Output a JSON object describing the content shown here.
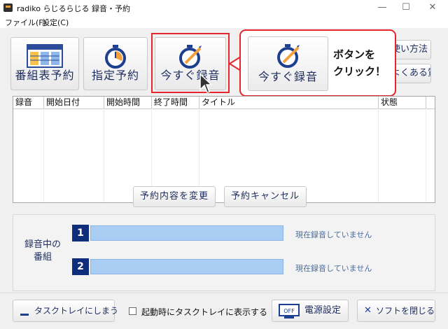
{
  "window": {
    "title": "radiko らじるらじる 録音・予約",
    "minimize_glyph": "—",
    "maximize_glyph": "☐",
    "close_glyph": "✕"
  },
  "menu": {
    "items": [
      "ファイル(F)",
      "設定(C)"
    ]
  },
  "toolbar": {
    "buttons": [
      {
        "label": "番組表予約",
        "icon": "program-table-icon"
      },
      {
        "label": "指定予約",
        "icon": "timer-icon"
      },
      {
        "label": "今すぐ録音",
        "icon": "stopwatch-pen-icon"
      }
    ],
    "right_buttons": [
      {
        "label": "使い方法"
      },
      {
        "label": "よくある質問"
      }
    ]
  },
  "callout": {
    "button_label": "今すぐ録音",
    "text_line1": "ボタンを",
    "text_line2": "クリック！"
  },
  "list": {
    "columns": [
      "録音",
      "開始日付",
      "開始時間",
      "終了時間",
      "タイトル",
      "状態"
    ]
  },
  "actions": {
    "change": "予約内容を変更",
    "cancel": "予約キャンセル"
  },
  "recording": {
    "label_line1": "録音中の",
    "label_line2": "番組",
    "slots": [
      {
        "num": "1",
        "status": "現在録音していません"
      },
      {
        "num": "2",
        "status": "現在録音していません"
      }
    ]
  },
  "footer": {
    "tray_button": "タスクトレイにしまう",
    "startup_checkbox": "起動時にタスクトレイに表示する",
    "startup_checked": false,
    "power_button": "電源設定",
    "power_icon_text": "OFF",
    "close_button": "ソフトを閉じる"
  },
  "colors": {
    "accent_red": "#e5262d",
    "navy": "#1d2c5e",
    "bar_blue": "#a9cdf3"
  }
}
